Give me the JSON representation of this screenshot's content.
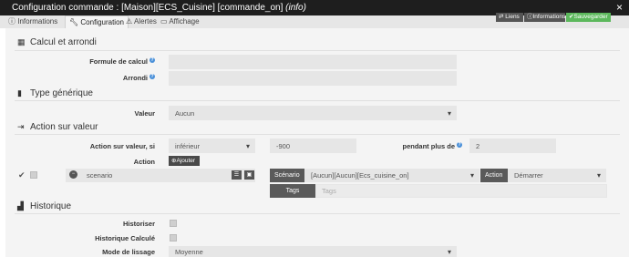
{
  "window": {
    "title": "Configuration commande : [Maison][ECS_Cuisine] [commande_on] ",
    "title_info": "(info)",
    "close_symbol": "×"
  },
  "tabs": [
    {
      "label": "Informations",
      "icon": "info-icon"
    },
    {
      "label": "Configuration",
      "icon": "wrench-icon"
    },
    {
      "label": "Alertes",
      "icon": "warning-icon"
    },
    {
      "label": "Affichage",
      "icon": "display-icon"
    }
  ],
  "toolbar": {
    "liens_label": "Liens",
    "informations_label": "Informations",
    "sauvegarder_label": "Sauvegarder",
    "colors": {
      "dark": "#555555",
      "save": "#5cb85c"
    }
  },
  "sections": {
    "calcul": {
      "title": "Calcul et arrondi",
      "formule_label": "Formule de calcul",
      "formule_value": "",
      "arrondi_label": "Arrondi",
      "arrondi_value": ""
    },
    "type": {
      "title": "Type générique",
      "valeur_label": "Valeur",
      "valeur_value": "Aucun"
    },
    "action": {
      "title": "Action sur valeur",
      "action_si_label": "Action sur valeur, si",
      "operator_value": "inférieur",
      "threshold_value": "-900",
      "duration_label": "pendant plus de",
      "duration_value": "2",
      "action_label": "Action",
      "add_button_label": "Ajouter",
      "row": {
        "check_symbol": "✔",
        "cmd_placeholder": "scenario",
        "scenario_label": "Scénario",
        "scenario_value": "[Aucun][Aucun][Ecs_cuisine_on]",
        "action_label": "Action",
        "action_value": "Démarrer",
        "tags_label": "Tags",
        "tags_placeholder": "Tags"
      }
    },
    "historique": {
      "title": "Historique",
      "historiser_label": "Historiser",
      "historique_calcule_label": "Historique Calculé",
      "mode_lissage_label": "Mode de lissage",
      "mode_lissage_value": "Moyenne"
    }
  }
}
